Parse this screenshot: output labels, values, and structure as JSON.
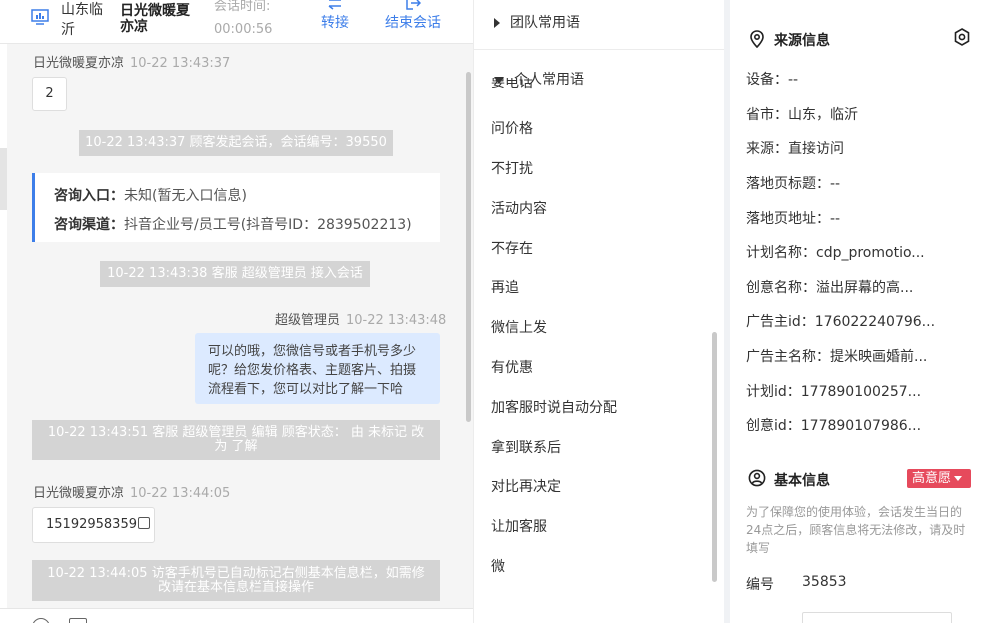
{
  "header": {
    "location": "山东临沂",
    "customer_name": "日光微暖夏亦凉",
    "session_time_label": "会话时间:",
    "session_time_value": "00:00:56",
    "transfer_label": "转接",
    "end_label": "结束会话"
  },
  "chat": {
    "msg1": {
      "sender": "日光微暖夏亦凉",
      "time": "10-22 13:43:37",
      "text": "2"
    },
    "sys1": "10-22 13:43:37 顾客发起会话，会话编号：39550",
    "card": {
      "entry_key": "咨询入口：",
      "entry_val": "未知(暂无入口信息)",
      "channel_key": "咨询渠道：",
      "channel_val": "抖音企业号/员工号(抖音号ID：2839502213)"
    },
    "sys2": "10-22 13:43:38 客服 超级管理员 接入会话",
    "msg2": {
      "sender": "超级管理员",
      "time": "10-22 13:43:48",
      "line1": "可以的哦，您微信号或者手机号多少",
      "line2": "呢？给您发价格表、主题客片、拍摄",
      "line3": "流程看下，您可以对比了解一下哈"
    },
    "sys3_line1": "10-22 13:43:51 客服 超级管理员 编辑 顾客状态： 由 未标记 改",
    "sys3_line2": "为 了解",
    "msg3": {
      "sender": "日光微暖夏亦凉",
      "time": "10-22 13:44:05",
      "text": "15192958359"
    },
    "sys4_line1": "10-22 13:44:05 访客手机号已自动标记右侧基本信息栏，如需修",
    "sys4_line2": "改请在基本信息栏直接操作"
  },
  "phrases": {
    "team_group": "团队常用语",
    "personal_group": "个人常用语",
    "partial_item": "要电话",
    "items": [
      "问价格",
      "不打扰",
      "活动内容",
      "不存在",
      "再追",
      "微信上发",
      "有优惠",
      "加客服时说自动分配",
      "拿到联系后",
      "对比再决定",
      "让加客服",
      "微"
    ]
  },
  "source_info": {
    "title": "来源信息",
    "device": "设备：--",
    "province": "省市：山东，临沂",
    "source": "来源：直接访问",
    "landing_title": "落地页标题：--",
    "landing_url": "落地页地址：--",
    "plan_name": "计划名称：cdp_promotio...",
    "creative_name": "创意名称：溢出屏幕的高...",
    "advertiser_id": "广告主id：176022240796...",
    "advertiser_name": "广告主名称：提米映画婚前...",
    "plan_id": "计划id：177890100257...",
    "creative_id": "创意id：177890107986..."
  },
  "basic_info": {
    "title": "基本信息",
    "intent_badge": "高意愿",
    "hint": "为了保障您的使用体验，会话发生当日的24点之后，顾客信息将无法修改，请及时填写",
    "number_label": "编号",
    "number_value": "35853"
  }
}
